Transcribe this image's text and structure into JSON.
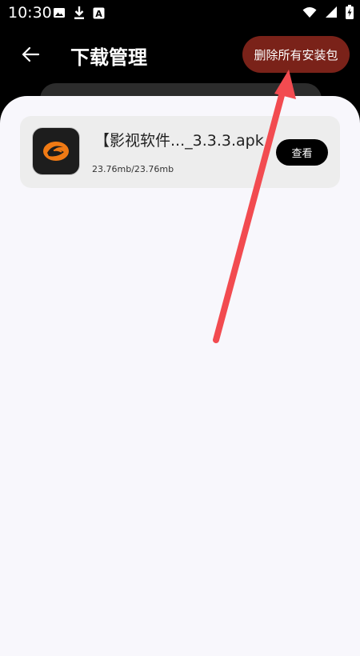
{
  "status_bar": {
    "time": "10:30",
    "left_icons": [
      "image-icon",
      "download-icon",
      "text-a-icon"
    ],
    "right_icons": [
      "wifi-icon",
      "signal-icon",
      "battery-charging-icon"
    ]
  },
  "header": {
    "title": "下载管理",
    "delete_all_label": "删除所有安装包",
    "delete_all_color": "#7a2219"
  },
  "downloads": [
    {
      "file_name": "【影视软件..._3.3.3.apk",
      "size_text": "23.76mb/23.76mb",
      "view_label": "查看",
      "icon": "app-logo-icon"
    }
  ],
  "annotation": {
    "type": "arrow",
    "color": "#f24b50"
  }
}
